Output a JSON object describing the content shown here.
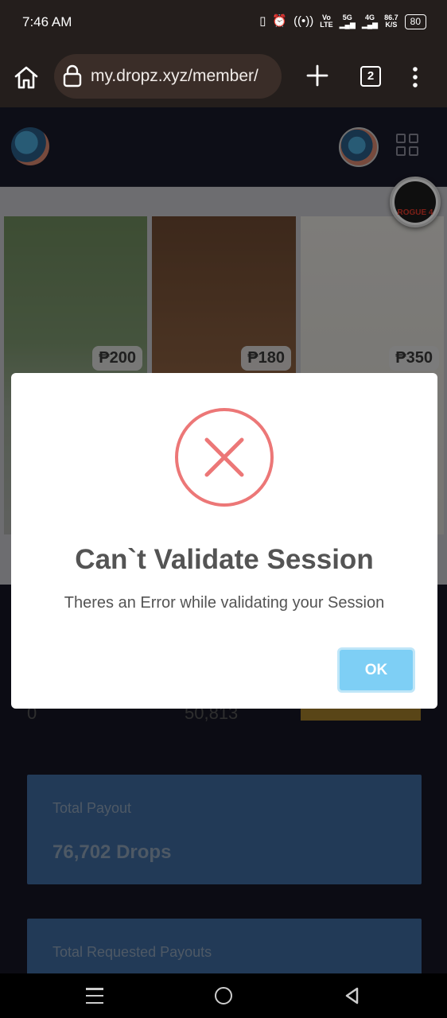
{
  "status_bar": {
    "time": "7:46 AM",
    "network_label_top": "Vo",
    "network_label_bottom": "LTE",
    "gen_5g": "5G",
    "gen_4g": "4G",
    "speed_value": "86.7",
    "speed_unit": "K/S",
    "battery": "80"
  },
  "browser": {
    "url": "my.dropz.xyz/member/",
    "tab_count": "2"
  },
  "products": [
    {
      "price": "₱200"
    },
    {
      "price": "₱180"
    },
    {
      "price": "₱350"
    }
  ],
  "dashboard": {
    "stat_left": "0",
    "stat_mid": "50,813",
    "total_payout_label": "Total Payout",
    "total_payout_value": "76,702 Drops",
    "total_requested_label": "Total Requested Payouts"
  },
  "modal": {
    "title": "Can`t Validate Session",
    "message": "Theres an Error while validating your Session",
    "ok_label": "OK"
  },
  "float_badge": {
    "text": "ROGUE 4"
  },
  "colors": {
    "error_red": "#ec7070",
    "ok_button": "#7ecff5",
    "card_blue": "#3e6a9e",
    "accent_gold": "#a27e2b"
  }
}
